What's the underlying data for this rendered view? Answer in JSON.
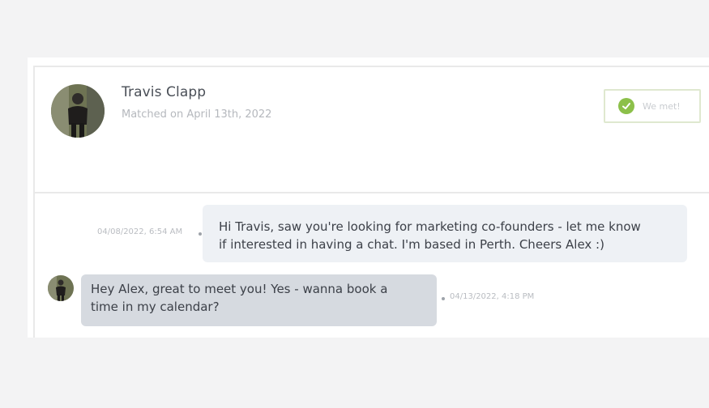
{
  "match": {
    "name": "Travis Clapp",
    "matched_on": "Matched on April 13th, 2022",
    "met_button_label": "We met!"
  },
  "messages": [
    {
      "direction": "outgoing",
      "timestamp": "04/08/2022, 6:54 AM",
      "line1": "Hi Travis, saw you're looking for marketing co-founders - let me know",
      "line2": "if interested in having a chat. I'm based in Perth. Cheers Alex :)"
    },
    {
      "direction": "incoming",
      "timestamp": "04/13/2022, 4:18 PM",
      "line1": "Hey Alex, great to meet you! Yes - wanna book a",
      "line2": "time in my calendar?"
    }
  ],
  "colors": {
    "page_background": "#f3f3f4",
    "card_background": "#ffffff",
    "outgoing_bubble": "#eef1f5",
    "incoming_bubble": "#d6dae0",
    "met_check": "#8cc04a"
  },
  "icons": {
    "met": "check-circle-icon",
    "avatar": "profile-photo"
  }
}
